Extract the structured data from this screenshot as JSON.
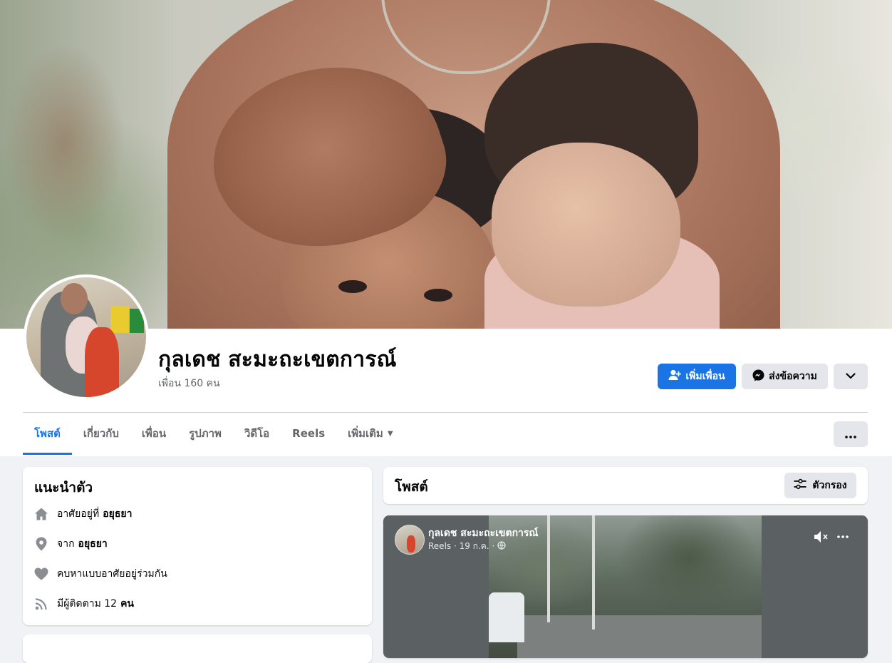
{
  "profile": {
    "name": "กุลเดช สะมะถะเขตการณ์",
    "friends": "เพื่อน 160 คน"
  },
  "actions": {
    "add_friend": "เพิ่มเพื่อน",
    "message": "ส่งข้อความ"
  },
  "tabs": [
    {
      "label": "โพสต์"
    },
    {
      "label": "เกี่ยวกับ"
    },
    {
      "label": "เพื่อน"
    },
    {
      "label": "รูปภาพ"
    },
    {
      "label": "วิดีโอ"
    },
    {
      "label": "Reels"
    },
    {
      "label": "เพิ่มเติม"
    }
  ],
  "intro": {
    "title": "แนะนำตัว",
    "lives_prefix": "อาศัยอยู่ที่",
    "lives_value": "อยุธยา",
    "from_prefix": "จาก",
    "from_value": "อยุธยา",
    "relationship": "คบหาแบบอาศัยอยู่ร่วมกัน",
    "followers_prefix": "มีผู้ติดตาม 12",
    "followers_unit": "คน"
  },
  "posts": {
    "title": "โพสต์",
    "filter_label": "ตัวกรอง"
  },
  "reel": {
    "author": "กุลเดช สะมะถะเขตการณ์",
    "meta": "Reels · 19 ก.ค. ·"
  },
  "colors": {
    "accent": "#1b74e4",
    "background": "#f0f2f5",
    "button_gray": "#e4e6eb",
    "secondary_text": "#65676b"
  }
}
